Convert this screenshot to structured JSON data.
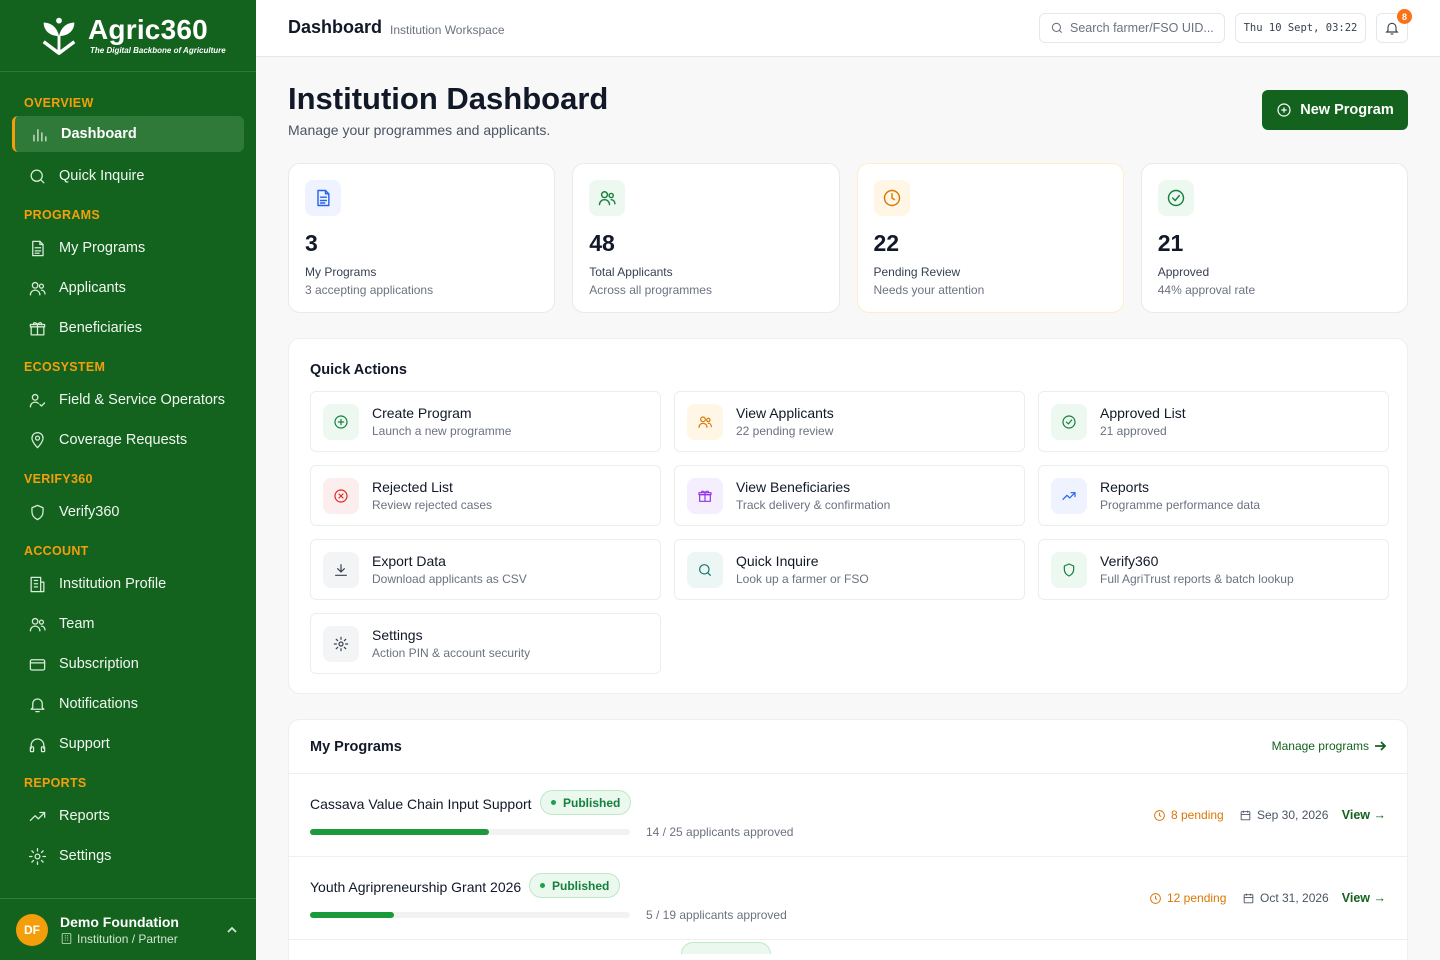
{
  "brand": {
    "name": "Agric360",
    "tagline": "The Digital Backbone of Agriculture"
  },
  "sidebar": {
    "sections": [
      {
        "title": "OVERVIEW",
        "items": [
          {
            "label": "Dashboard",
            "icon": "bar-chart-icon",
            "active": true
          },
          {
            "label": "Quick Inquire",
            "icon": "search-icon"
          }
        ]
      },
      {
        "title": "PROGRAMS",
        "items": [
          {
            "label": "My Programs",
            "icon": "document-icon"
          },
          {
            "label": "Applicants",
            "icon": "users-icon"
          },
          {
            "label": "Beneficiaries",
            "icon": "gift-icon"
          }
        ]
      },
      {
        "title": "ECOSYSTEM",
        "items": [
          {
            "label": "Field & Service Operators",
            "icon": "user-check-icon"
          },
          {
            "label": "Coverage Requests",
            "icon": "map-pin-icon"
          }
        ]
      },
      {
        "title": "VERIFY360",
        "items": [
          {
            "label": "Verify360",
            "icon": "shield-icon"
          }
        ]
      },
      {
        "title": "ACCOUNT",
        "items": [
          {
            "label": "Institution Profile",
            "icon": "building-icon"
          },
          {
            "label": "Team",
            "icon": "users-icon"
          },
          {
            "label": "Subscription",
            "icon": "credit-card-icon"
          },
          {
            "label": "Notifications",
            "icon": "bell-icon"
          },
          {
            "label": "Support",
            "icon": "headphones-icon"
          }
        ]
      },
      {
        "title": "REPORTS",
        "items": [
          {
            "label": "Reports",
            "icon": "trending-up-icon"
          },
          {
            "label": "Settings",
            "icon": "gear-icon"
          }
        ]
      }
    ],
    "user": {
      "initials": "DF",
      "name": "Demo Foundation",
      "role": "Institution / Partner"
    }
  },
  "topbar": {
    "title": "Dashboard",
    "subtitle": "Institution Workspace",
    "search_placeholder": "Search farmer/FSO UID...",
    "datetime": "Thu 10 Sept, 03:22",
    "notifications_count": "8"
  },
  "page": {
    "title": "Institution Dashboard",
    "subtitle": "Manage your programmes and applicants.",
    "new_program_label": "New Program"
  },
  "stats": [
    {
      "value": "3",
      "label": "My Programs",
      "note": "3 accepting applications",
      "icon": "document-icon",
      "color": "#2563eb",
      "bg": "#eef3ff"
    },
    {
      "value": "48",
      "label": "Total Applicants",
      "note": "Across all programmes",
      "icon": "users-icon",
      "color": "#15803d",
      "bg": "#edf8f0"
    },
    {
      "value": "22",
      "label": "Pending Review",
      "note": "Needs your attention",
      "icon": "clock-icon",
      "color": "#d97706",
      "bg": "#fff6e6"
    },
    {
      "value": "21",
      "label": "Approved",
      "note": "44% approval rate",
      "icon": "check-circle-icon",
      "color": "#15803d",
      "bg": "#edf8f0"
    }
  ],
  "quick_actions": {
    "title": "Quick Actions",
    "items": [
      {
        "name": "Create Program",
        "desc": "Launch a new programme",
        "icon": "plus-circle-icon",
        "color": "#15803d",
        "bg": "#edf8f0"
      },
      {
        "name": "View Applicants",
        "desc": "22 pending review",
        "icon": "users-icon",
        "color": "#d97706",
        "bg": "#fff6e6"
      },
      {
        "name": "Approved List",
        "desc": "21 approved",
        "icon": "check-circle-icon",
        "color": "#15803d",
        "bg": "#edf8f0"
      },
      {
        "name": "Rejected List",
        "desc": "Review rejected cases",
        "icon": "x-circle-icon",
        "color": "#dc2626",
        "bg": "#fdeeee"
      },
      {
        "name": "View Beneficiaries",
        "desc": "Track delivery & confirmation",
        "icon": "gift-icon",
        "color": "#9333ea",
        "bg": "#f5eefe"
      },
      {
        "name": "Reports",
        "desc": "Programme performance data",
        "icon": "trending-up-icon",
        "color": "#2563eb",
        "bg": "#eef3ff"
      },
      {
        "name": "Export Data",
        "desc": "Download applicants as CSV",
        "icon": "download-icon",
        "color": "#374151",
        "bg": "#f3f4f6"
      },
      {
        "name": "Quick Inquire",
        "desc": "Look up a farmer or FSO",
        "icon": "search-icon",
        "color": "#0f766e",
        "bg": "#ecf7f5"
      },
      {
        "name": "Verify360",
        "desc": "Full AgriTrust reports & batch lookup",
        "icon": "shield-icon",
        "color": "#15803d",
        "bg": "#edf8f0"
      },
      {
        "name": "Settings",
        "desc": "Action PIN & account security",
        "icon": "gear-icon",
        "color": "#374151",
        "bg": "#f3f4f6"
      }
    ]
  },
  "programs": {
    "title": "My Programs",
    "manage_label": "Manage programs",
    "rows": [
      {
        "name": "Cassava Value Chain Input Support",
        "status": "Published",
        "approved": 14,
        "total": 25,
        "count_label": "14 / 25 applicants approved",
        "pending": "8 pending",
        "date": "Sep 30, 2026",
        "view": "View →"
      },
      {
        "name": "Youth Agripreneurship Grant 2026",
        "status": "Published",
        "approved": 5,
        "total": 19,
        "count_label": "5 / 19 applicants approved",
        "pending": "12 pending",
        "date": "Oct 31, 2026",
        "view": "View →"
      }
    ]
  }
}
